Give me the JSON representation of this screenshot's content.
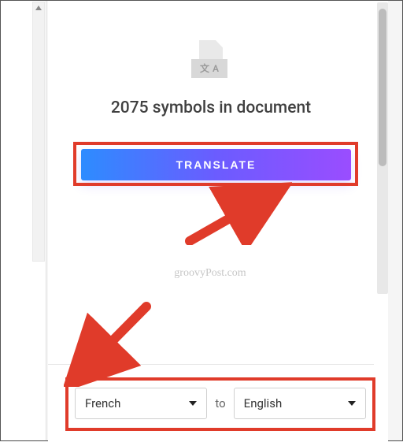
{
  "header": {
    "symbol_count_text": "2075 symbols in document"
  },
  "translate": {
    "button_label": "TRANSLATE"
  },
  "watermark": {
    "text": "groovyPost.com"
  },
  "languages": {
    "source": "French",
    "target": "English",
    "separator": "to"
  },
  "icon": {
    "glyph_left": "文",
    "glyph_right": "A"
  }
}
